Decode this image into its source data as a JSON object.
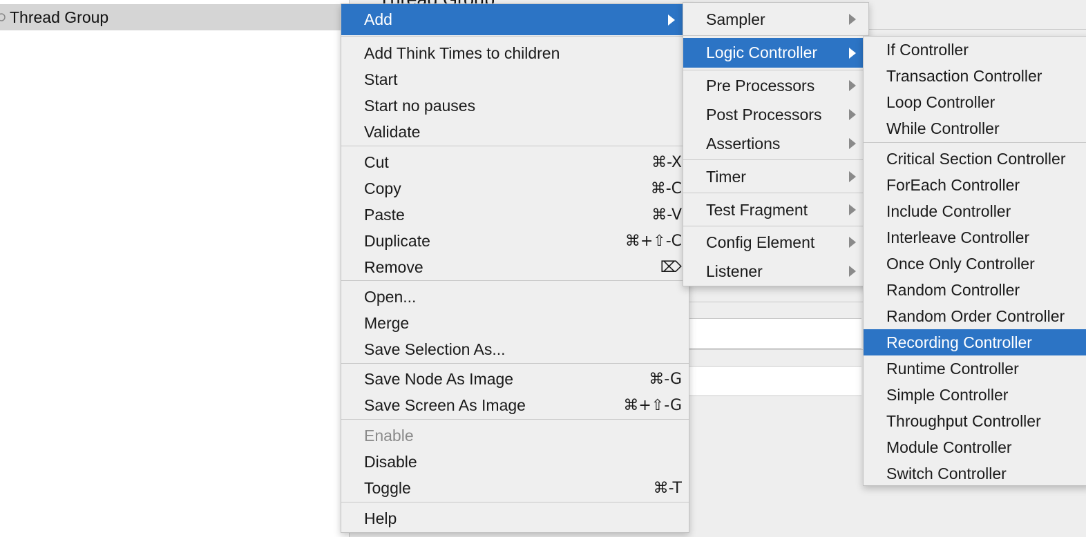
{
  "tree": {
    "selected_item": "Thread Group"
  },
  "content": {
    "title": "Thread Group"
  },
  "context_menu": {
    "items": [
      {
        "label": "Add",
        "selected": true,
        "submenu": true
      },
      {
        "label": "Add Think Times to children"
      },
      {
        "label": "Start"
      },
      {
        "label": "Start no pauses"
      },
      {
        "label": "Validate"
      },
      {
        "label": "Cut",
        "shortcut": "⌘-X"
      },
      {
        "label": "Copy",
        "shortcut": "⌘-C"
      },
      {
        "label": "Paste",
        "shortcut": "⌘-V"
      },
      {
        "label": "Duplicate",
        "shortcut": "⌘+⇧-C"
      },
      {
        "label": "Remove",
        "shortcut": "⌦"
      },
      {
        "label": "Open..."
      },
      {
        "label": "Merge"
      },
      {
        "label": "Save Selection As..."
      },
      {
        "label": "Save Node As Image",
        "shortcut": "⌘-G"
      },
      {
        "label": "Save Screen As Image",
        "shortcut": "⌘+⇧-G"
      },
      {
        "label": "Enable",
        "disabled": true
      },
      {
        "label": "Disable"
      },
      {
        "label": "Toggle",
        "shortcut": "⌘-T"
      },
      {
        "label": "Help"
      }
    ]
  },
  "add_submenu": {
    "items": [
      {
        "label": "Sampler",
        "submenu": true
      },
      {
        "label": "Logic Controller",
        "selected": true,
        "submenu": true
      },
      {
        "label": "Pre Processors",
        "submenu": true
      },
      {
        "label": "Post Processors",
        "submenu": true
      },
      {
        "label": "Assertions",
        "submenu": true
      },
      {
        "label": "Timer",
        "submenu": true
      },
      {
        "label": "Test Fragment",
        "submenu": true
      },
      {
        "label": "Config Element",
        "submenu": true
      },
      {
        "label": "Listener",
        "submenu": true
      }
    ]
  },
  "logic_controller_submenu": {
    "items": [
      {
        "label": "If Controller"
      },
      {
        "label": "Transaction Controller"
      },
      {
        "label": "Loop Controller"
      },
      {
        "label": "While Controller"
      },
      {
        "label": "Critical Section Controller"
      },
      {
        "label": "ForEach Controller"
      },
      {
        "label": "Include Controller"
      },
      {
        "label": "Interleave Controller"
      },
      {
        "label": "Once Only Controller"
      },
      {
        "label": "Random Controller"
      },
      {
        "label": "Random Order Controller"
      },
      {
        "label": "Recording Controller",
        "selected": true
      },
      {
        "label": "Runtime Controller"
      },
      {
        "label": "Simple Controller"
      },
      {
        "label": "Throughput Controller"
      },
      {
        "label": "Module Controller"
      },
      {
        "label": "Switch Controller"
      }
    ]
  },
  "colors": {
    "selection": "#2c74c5",
    "menu_background": "#efefef",
    "tree_selection": "#d5d5d5",
    "disabled_text": "#8a8a8a"
  }
}
